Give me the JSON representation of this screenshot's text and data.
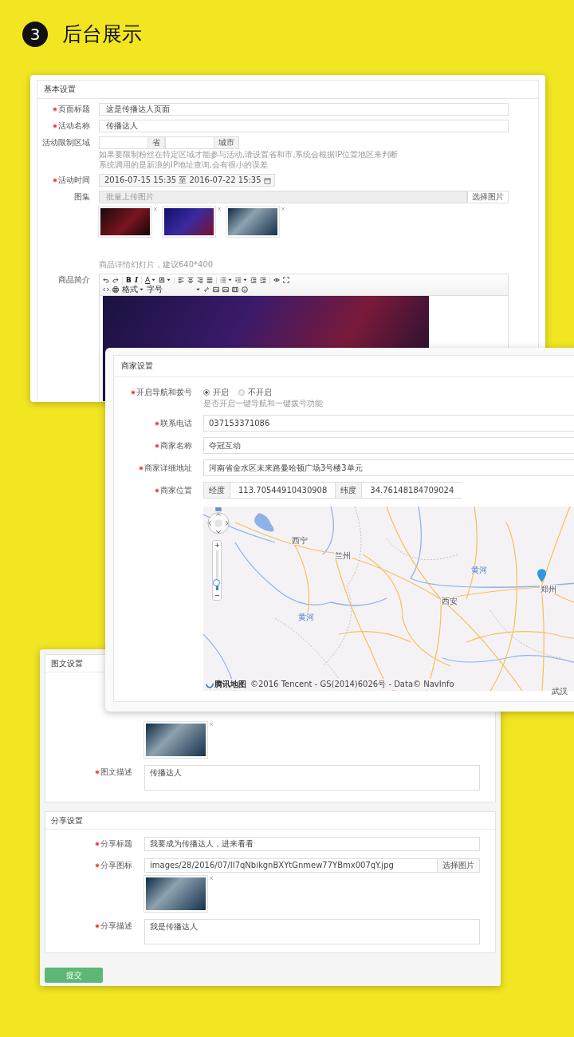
{
  "header": {
    "step": "3",
    "title": "后台展示"
  },
  "basic": {
    "title": "基本设置",
    "rows": [
      {
        "kind": "text",
        "label": "页面标题",
        "required": true,
        "value": "这是传播达人页面"
      },
      {
        "kind": "text",
        "label": "活动名称",
        "required": true,
        "value": "传播达人"
      },
      {
        "kind": "region",
        "label": "活动限制区域",
        "addons": [
          "省",
          "城市"
        ],
        "help": [
          "如果要限制粉丝在特定区域才能参与活动,请设置省和市,系统会根据IP位置地区来判断",
          "系统调用的是新浪的IP地址查询,会有很小的误差"
        ]
      },
      {
        "kind": "daterange",
        "label": "活动时间",
        "required": true,
        "value": "2016-07-15 15:35 至 2016-07-22 15:35"
      },
      {
        "kind": "gallery",
        "label": "图集",
        "placeholder": "批量上传图片",
        "button": "选择图片",
        "images": [
          {
            "removable": true
          },
          {
            "removable": true
          },
          {
            "removable": true
          }
        ],
        "help": "商品详情幻灯片，建议640*400"
      },
      {
        "kind": "editor",
        "label": "商品简介",
        "toolbar": [
          [
            {
              "kind": "undo"
            },
            {
              "kind": "redo"
            },
            {
              "kind": "separator"
            },
            {
              "kind": "bold",
              "label": "B"
            },
            {
              "kind": "italic",
              "label": "I"
            },
            {
              "kind": "separator"
            },
            {
              "kind": "font-color",
              "label": "A",
              "dropdown": true
            },
            {
              "kind": "highlight",
              "dropdown": true
            },
            {
              "kind": "separator"
            },
            {
              "kind": "align-left"
            },
            {
              "kind": "align-center"
            },
            {
              "kind": "align-right"
            },
            {
              "kind": "justify"
            },
            {
              "kind": "separator"
            },
            {
              "kind": "ul",
              "dropdown": true
            },
            {
              "kind": "ol",
              "dropdown": true
            },
            {
              "kind": "outdent"
            },
            {
              "kind": "indent"
            },
            {
              "kind": "separator"
            },
            {
              "kind": "eye"
            },
            {
              "kind": "fullscreen"
            }
          ],
          [
            {
              "kind": "code"
            },
            {
              "kind": "print"
            },
            {
              "kind": "format",
              "label": "格式",
              "dropdown": true
            },
            {
              "kind": "size",
              "label": "字号",
              "dropdown": true
            },
            {
              "kind": "link"
            },
            {
              "kind": "image"
            },
            {
              "kind": "image"
            },
            {
              "kind": "video"
            },
            {
              "kind": "emoji"
            }
          ]
        ]
      }
    ]
  },
  "merchant": {
    "title": "商家设置",
    "nav": {
      "label": "开启导航和拨号",
      "required": true,
      "options": [
        {
          "label": "开启",
          "selected": true
        },
        {
          "label": "不开启",
          "selected": false
        }
      ],
      "help": "是否开启一键导航和一键拨号功能"
    },
    "fields": [
      {
        "label": "联系电话",
        "required": true,
        "value": "037153371086"
      },
      {
        "label": "商家名称",
        "required": true,
        "value": "夺冠互动"
      },
      {
        "label": "商家详细地址",
        "required": true,
        "value": "河南省金水区未来路曼哈顿广场3号楼3单元"
      }
    ],
    "location": {
      "label": "商家位置",
      "required": true,
      "lng_label": "经度",
      "lng": "113.70544910430908",
      "lat_label": "纬度",
      "lat": "34.76148184709024"
    },
    "map": {
      "cities": [
        "西宁",
        "兰州",
        "西安",
        "郑州",
        "武汉"
      ],
      "rivers": [
        "黄河",
        "黄河"
      ],
      "logo": "腾讯地图",
      "copyright": "©2016 Tencent - GS(2014)6026号 - Data© NavInfo",
      "zoom": {
        "level": 0.2
      }
    }
  },
  "article": {
    "title": "图文设置",
    "images": [
      {
        "removable": true
      }
    ],
    "desc": {
      "label": "图文描述",
      "required": true,
      "value": "传播达人"
    }
  },
  "share": {
    "title": "分享设置",
    "share_title": {
      "label": "分享标题",
      "required": true,
      "value": "我要成为传播达人，进来看看"
    },
    "icon": {
      "label": "分享图标",
      "required": true,
      "value": "images/28/2016/07/II7qNbikgnBXYtGnmew77YBmx007qY.jpg",
      "button": "选择图片",
      "images": [
        {
          "removable": true
        }
      ]
    },
    "desc": {
      "label": "分享描述",
      "required": true,
      "value": "我是传播达人"
    }
  },
  "submit": "提交"
}
